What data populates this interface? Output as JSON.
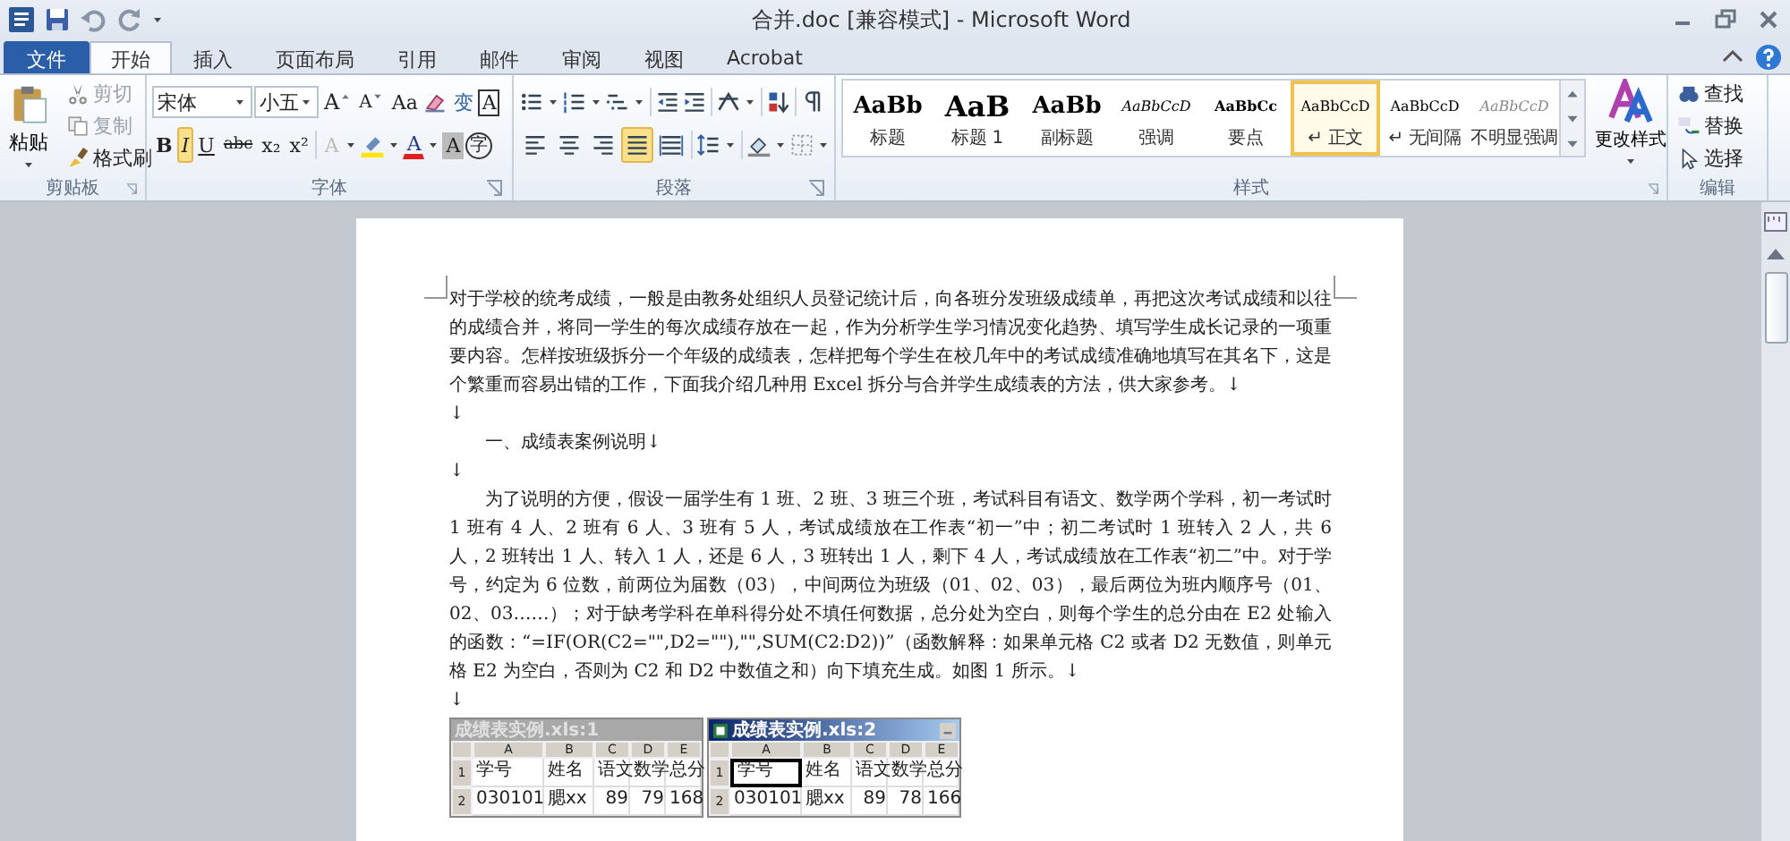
{
  "title": "合并.doc [兼容模式] - Microsoft Word",
  "tabs": [
    {
      "label": "文件",
      "kind": "file",
      "selected": false
    },
    {
      "label": "开始",
      "kind": "tab",
      "selected": true
    },
    {
      "label": "插入",
      "kind": "tab",
      "selected": false
    },
    {
      "label": "页面布局",
      "kind": "tab",
      "selected": false
    },
    {
      "label": "引用",
      "kind": "tab",
      "selected": false
    },
    {
      "label": "邮件",
      "kind": "tab",
      "selected": false
    },
    {
      "label": "审阅",
      "kind": "tab",
      "selected": false
    },
    {
      "label": "视图",
      "kind": "tab",
      "selected": false
    },
    {
      "label": "Acrobat",
      "kind": "tab",
      "selected": false
    }
  ],
  "clipboard": {
    "title": "剪贴板",
    "paste": "粘贴",
    "items": [
      {
        "label": "剪切",
        "kind": "cut",
        "disabled": true
      },
      {
        "label": "复制",
        "kind": "copy",
        "disabled": true
      },
      {
        "label": "格式刷",
        "kind": "painter",
        "disabled": false
      }
    ]
  },
  "font": {
    "title": "字体",
    "font_name": "宋体",
    "font_size": "小五",
    "row1": [
      {
        "label": "A",
        "kind": "grow"
      },
      {
        "label": "A",
        "kind": "shrink"
      },
      {
        "label": "Aa",
        "kind": "case"
      },
      {
        "kind": "clear"
      },
      {
        "label": "变",
        "kind": "phonetic"
      },
      {
        "label": "A",
        "kind": "border"
      }
    ],
    "toggles": [
      {
        "label": "B",
        "kind": "bold",
        "selected": false
      },
      {
        "label": "I",
        "kind": "italic",
        "selected": true
      },
      {
        "label": "U",
        "kind": "underline",
        "selected": false
      },
      {
        "label": "abc",
        "kind": "strike",
        "selected": false
      },
      {
        "label": "x₂",
        "kind": "sub",
        "selected": false
      },
      {
        "label": "x²",
        "kind": "sup",
        "selected": false
      }
    ],
    "color_tools": [
      {
        "label": "A",
        "kind": "effect"
      },
      {
        "kind": "highlight"
      },
      {
        "label": "A",
        "kind": "color"
      },
      {
        "label": "A",
        "kind": "shading"
      },
      {
        "label": "字",
        "kind": "enclose"
      }
    ]
  },
  "paragraph": {
    "title": "段落",
    "alignment": [
      {
        "kind": "left",
        "selected": false
      },
      {
        "kind": "center",
        "selected": false
      },
      {
        "kind": "right",
        "selected": false
      },
      {
        "kind": "justify",
        "selected": true
      },
      {
        "kind": "distributed",
        "selected": false
      }
    ]
  },
  "styles": {
    "title": "样式",
    "change": "更改样式",
    "items": [
      {
        "sample": "AaBb",
        "label": "标题",
        "kind": "title",
        "selected": false
      },
      {
        "sample": "AaB",
        "label": "标题 1",
        "kind": "heading",
        "selected": false
      },
      {
        "sample": "AaBb",
        "label": "副标题",
        "kind": "subtitle",
        "selected": false
      },
      {
        "sample": "AaBbCcD",
        "label": "强调",
        "kind": "emphasis",
        "selected": false
      },
      {
        "sample": "AaBbCc",
        "label": "要点",
        "kind": "strong",
        "selected": false
      },
      {
        "sample": "AaBbCcD",
        "label": "↵ 正文",
        "kind": "normal",
        "selected": true
      },
      {
        "sample": "AaBbCcD",
        "label": "↵ 无间隔",
        "kind": "normal",
        "selected": false
      },
      {
        "sample": "AaBbCcD",
        "label": "不明显强调",
        "kind": "subtle",
        "selected": false
      }
    ]
  },
  "editing": {
    "title": "编辑",
    "items": [
      {
        "label": "查找",
        "kind": "find"
      },
      {
        "label": "替换",
        "kind": "replace"
      },
      {
        "label": "选择",
        "kind": "select"
      }
    ]
  },
  "document": {
    "paragraphs": [
      {
        "kind": "plain",
        "text": "对于学校的统考成绩，一般是由教务处组织人员登记统计后，向各班分发班级成绩单，再把这次考试成绩和以往的成绩合并，将同一学生的每次成绩存放在一起，作为分析学生学习情况变化趋势、填写学生成长记录的一项重要内容。怎样按班级拆分一个年级的成绩表，怎样把每个学生在校几年中的考试成绩准确地填写在其名下，这是个繁重而容易出错的工作，下面我介绍几种用 Excel 拆分与合并学生成绩表的方法，供大家参考。↓"
      },
      {
        "kind": "plain",
        "text": "↓"
      },
      {
        "kind": "indented",
        "text": "一、成绩表案例说明↓"
      },
      {
        "kind": "plain",
        "text": "↓"
      },
      {
        "kind": "indented",
        "text": "为了说明的方便，假设一届学生有 1 班、2 班、3 班三个班，考试科目有语文、数学两个学科，初一考试时 1 班有 4 人、2 班有 6 人、3 班有 5 人，考试成绩放在工作表“初一”中；初二考试时 1 班转入 2 人，共 6 人，2 班转出 1 人、转入 1 人，还是 6 人，3 班转出 1 人，剩下 4 人，考试成绩放在工作表“初二”中。对于学号，约定为 6 位数，前两位为届数（03），中间两位为班级（01、02、03），最后两位为班内顺序号（01、02、03……）；对于缺考学科在单科得分处不填任何数据，总分处为空白，则每个学生的总分由在 E2 处输入的函数：“=IF(OR(C2=\"\",D2=\"\"),\"\",SUM(C2:D2))”（函数解释：如果单元格 C2 或者 D2 无数值，则单元格 E2 为空白，否则为 C2 和 D2 中数值之和）向下填充生成。如图 1 所示。↓"
      },
      {
        "kind": "plain",
        "text": "↓"
      }
    ],
    "figures": [
      {
        "title": "成绩表实例.xls:1",
        "active": false,
        "columns": [
          "A",
          "B",
          "C",
          "D",
          "E"
        ],
        "rows": [
          {
            "num": "1",
            "cells": [
              "学号",
              "姓名",
              "语文",
              "数学",
              "总分"
            ]
          },
          {
            "num": "2",
            "cells": [
              "030101",
              "腮xx",
              "89",
              "79",
              "168"
            ]
          }
        ]
      },
      {
        "title": "成绩表实例.xls:2",
        "active": true,
        "columns": [
          "A",
          "B",
          "C",
          "D",
          "E"
        ],
        "rows": [
          {
            "num": "1",
            "cells": [
              "学号",
              "姓名",
              "语文",
              "数学",
              "总分"
            ]
          },
          {
            "num": "2",
            "cells": [
              "030101",
              "腮xx",
              "89",
              "78",
              "166"
            ]
          }
        ]
      }
    ]
  }
}
